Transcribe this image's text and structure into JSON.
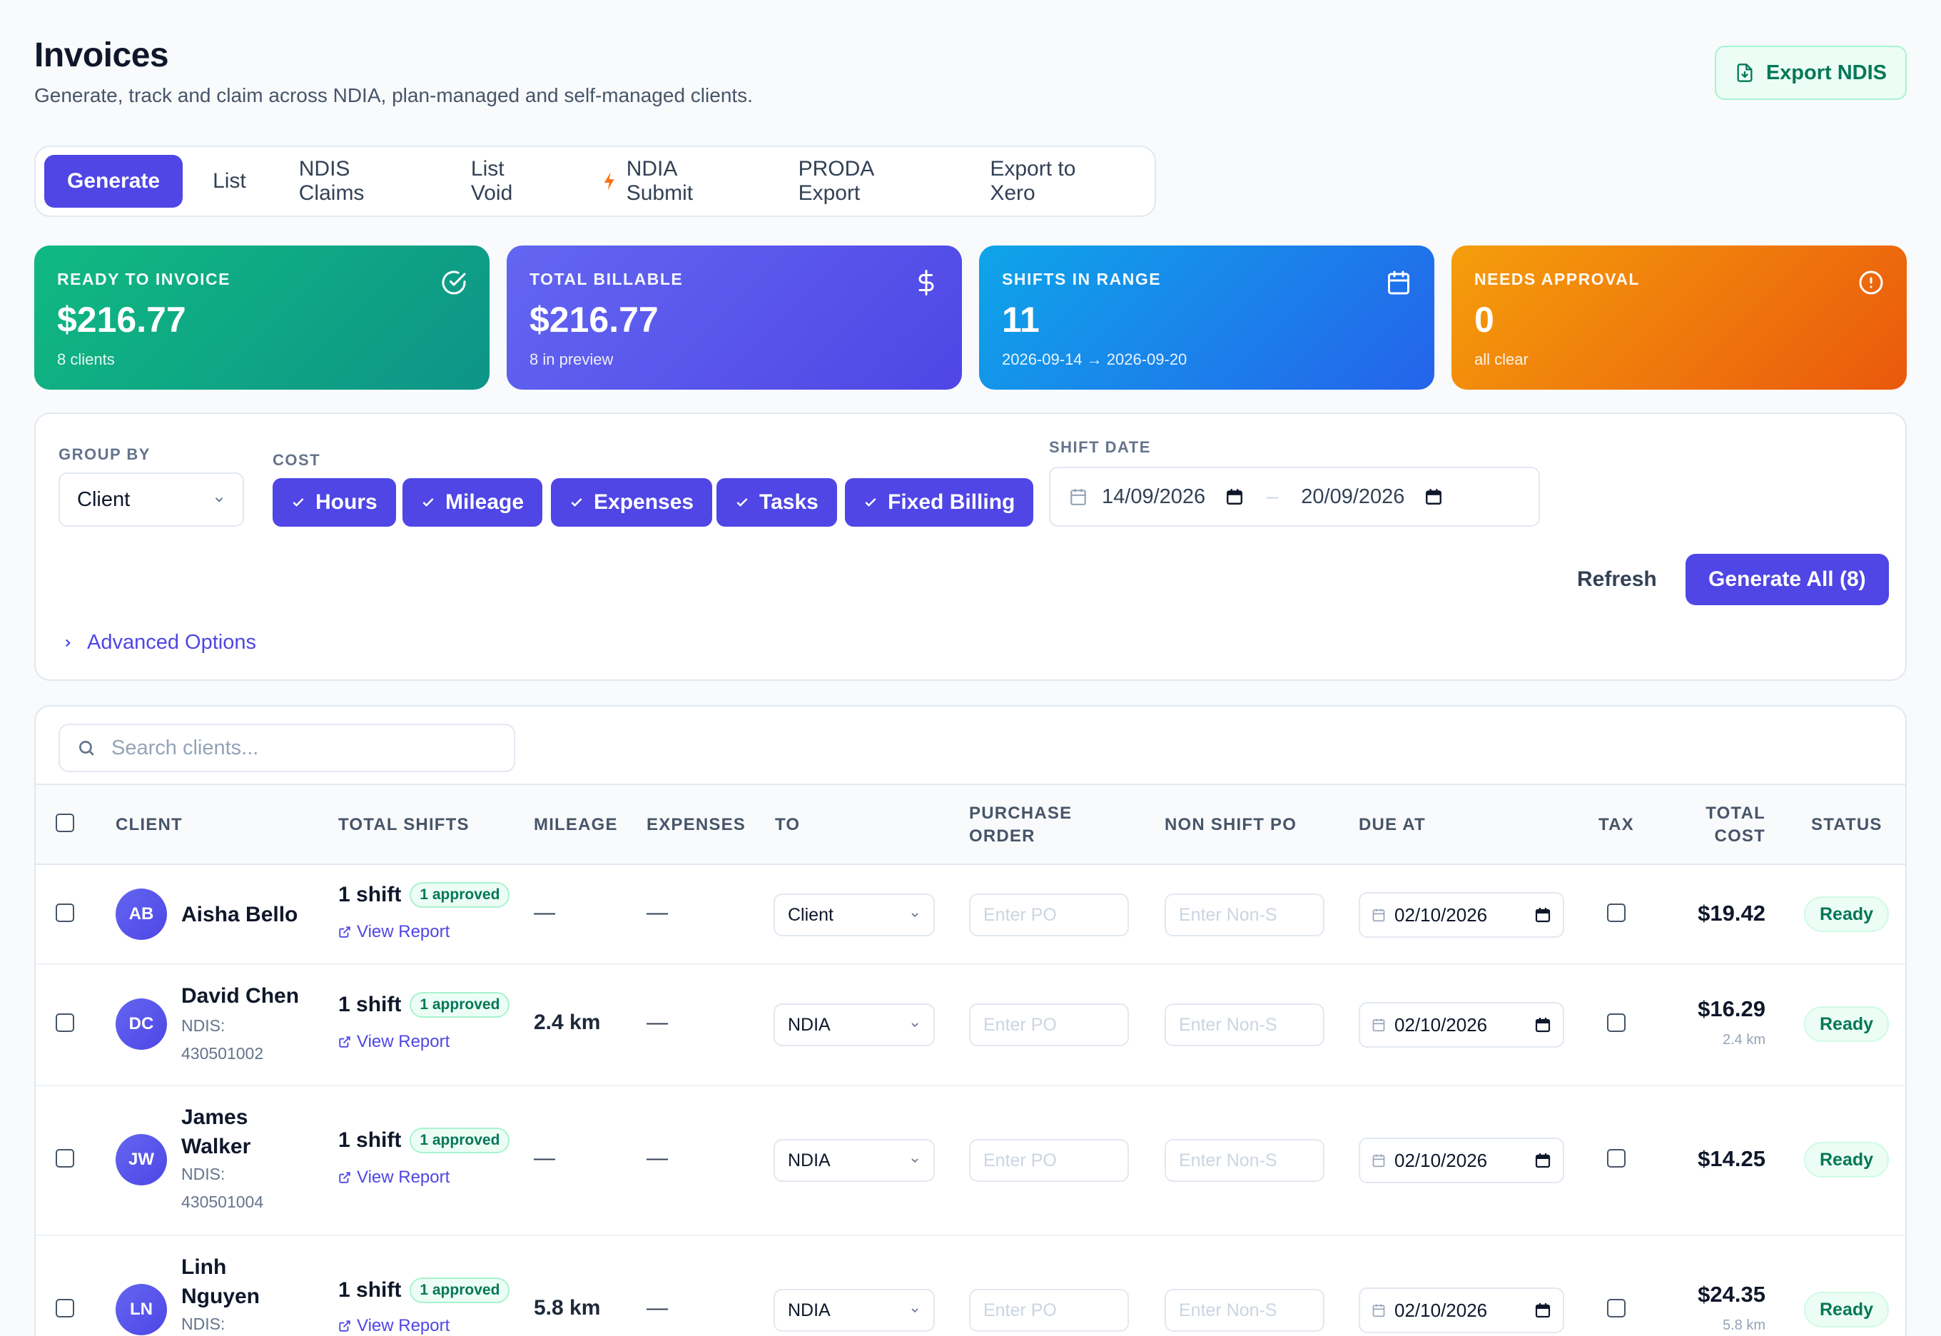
{
  "header": {
    "title": "Invoices",
    "subtitle": "Generate, track and claim across NDIA, plan-managed and self-managed clients.",
    "export_label": "Export NDIS"
  },
  "tabs": [
    {
      "label": "Generate",
      "active": true
    },
    {
      "label": "List"
    },
    {
      "label": "NDIS Claims"
    },
    {
      "label": "List Void"
    },
    {
      "label": "NDIA Submit",
      "icon": "bolt-icon"
    },
    {
      "label": "PRODA Export"
    },
    {
      "label": "Export to Xero"
    }
  ],
  "stats": [
    {
      "label": "READY TO INVOICE",
      "value": "$216.77",
      "sub": "8 clients",
      "icon": "check-circle-icon",
      "color": "#10b981"
    },
    {
      "label": "TOTAL BILLABLE",
      "value": "$216.77",
      "sub": "8 in preview",
      "icon": "dollar-icon",
      "color": "#4f46e5"
    },
    {
      "label": "SHIFTS IN RANGE",
      "value": "11",
      "sub": "2026-09-14 → 2026-09-20",
      "icon": "calendar-icon",
      "color": "#2563eb"
    },
    {
      "label": "NEEDS APPROVAL",
      "value": "0",
      "sub": "all clear",
      "icon": "alert-circle-icon",
      "color": "#ea580c"
    }
  ],
  "filters": {
    "group_by_label": "GROUP BY",
    "group_by_value": "Client",
    "cost_label": "COST",
    "cost_chips": [
      "Hours",
      "Mileage",
      "Expenses",
      "Tasks",
      "Fixed Billing"
    ],
    "shift_date_label": "SHIFT DATE",
    "date_from": "14/09/2026",
    "date_to": "20/09/2026",
    "refresh_label": "Refresh",
    "generate_all_label": "Generate All (8)",
    "advanced_label": "Advanced Options"
  },
  "table": {
    "search_placeholder": "Search clients...",
    "columns": {
      "client": "CLIENT",
      "total_shifts": "TOTAL SHIFTS",
      "mileage": "MILEAGE",
      "expenses": "EXPENSES",
      "to": "TO",
      "purchase_order_1": "PURCHASE",
      "purchase_order_2": "ORDER",
      "non_shift_po": "NON SHIFT PO",
      "due_at": "DUE AT",
      "tax": "TAX",
      "total_cost_1": "TOTAL",
      "total_cost_2": "COST",
      "status": "STATUS"
    },
    "po_placeholder": "Enter PO",
    "non_shift_placeholder": "Enter Non-S",
    "view_report": "View Report",
    "rows": [
      {
        "initials": "AB",
        "name1": "Aisha Bello",
        "name2": "",
        "ndis1": "",
        "ndis2": "",
        "shifts": "1 shift",
        "approved": "1 approved",
        "mileage": "—",
        "expenses": "—",
        "to": "Client",
        "due": "02/10/2026",
        "cost": "$19.42",
        "cost_sub": "",
        "status": "Ready"
      },
      {
        "initials": "DC",
        "name1": "David Chen",
        "name2": "",
        "ndis1": "NDIS:",
        "ndis2": "430501002",
        "shifts": "1 shift",
        "approved": "1 approved",
        "mileage": "2.4 km",
        "expenses": "—",
        "to": "NDIA",
        "due": "02/10/2026",
        "cost": "$16.29",
        "cost_sub": "2.4 km",
        "status": "Ready"
      },
      {
        "initials": "JW",
        "name1": "James",
        "name2": "Walker",
        "ndis1": "NDIS:",
        "ndis2": "430501004",
        "shifts": "1 shift",
        "approved": "1 approved",
        "mileage": "—",
        "expenses": "—",
        "to": "NDIA",
        "due": "02/10/2026",
        "cost": "$14.25",
        "cost_sub": "",
        "status": "Ready"
      },
      {
        "initials": "LN",
        "name1": "Linh",
        "name2": "Nguyen",
        "ndis1": "NDIS:",
        "ndis2": "",
        "shifts": "1 shift",
        "approved": "1 approved",
        "mileage": "5.8 km",
        "expenses": "—",
        "to": "NDIA",
        "due": "02/10/2026",
        "cost": "$24.35",
        "cost_sub": "5.8 km",
        "status": "Ready"
      }
    ]
  }
}
